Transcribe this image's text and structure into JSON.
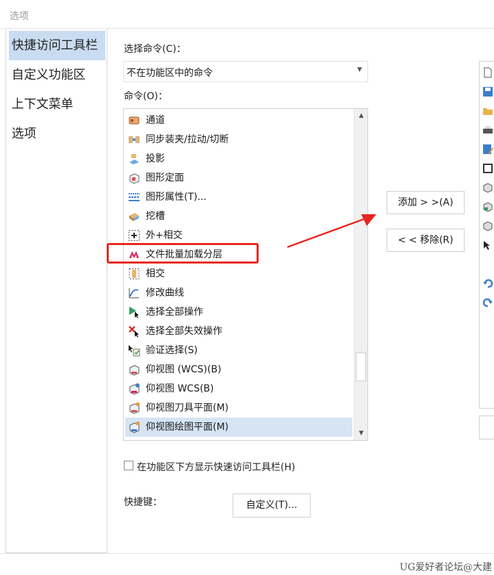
{
  "window": {
    "title": "选项"
  },
  "nav": {
    "items": [
      {
        "label": "快捷访问工具栏",
        "active": true
      },
      {
        "label": "自定义功能区",
        "active": false
      },
      {
        "label": "上下文菜单",
        "active": false
      },
      {
        "label": "选项",
        "active": false
      }
    ]
  },
  "main": {
    "choose_label": "选择命令(C)：",
    "combo_value": "不在功能区中的命令",
    "commands_label": "命令(O)：",
    "commands": [
      {
        "label": "通道",
        "icon": "channel-icon"
      },
      {
        "label": "同步装夹/拉动/切断",
        "icon": "sync-clamp-icon"
      },
      {
        "label": "投影",
        "icon": "projection-icon"
      },
      {
        "label": "图形定面",
        "icon": "graphic-plane-icon"
      },
      {
        "label": "图形属性(T)...",
        "icon": "graphic-attributes-icon"
      },
      {
        "label": "挖槽",
        "icon": "pocket-icon"
      },
      {
        "label": "外+相交",
        "icon": "outer-intersect-icon"
      },
      {
        "label": "文件批量加载分层",
        "icon": "batch-load-logo-icon"
      },
      {
        "label": "相交",
        "icon": "intersect-icon"
      },
      {
        "label": "修改曲线",
        "icon": "modify-curve-icon"
      },
      {
        "label": "选择全部操作",
        "icon": "select-all-ops-icon"
      },
      {
        "label": "选择全部失效操作",
        "icon": "select-invalid-ops-icon"
      },
      {
        "label": "验证选择(S)",
        "icon": "verify-select-icon"
      },
      {
        "label": "仰视图 (WCS)(B)",
        "icon": "bottom-view-wcs-b-icon"
      },
      {
        "label": "仰视图 WCS(B)",
        "icon": "bottom-view-wcs-icon"
      },
      {
        "label": "仰视图刀具平面(M)",
        "icon": "bottom-view-tool-plane-icon"
      },
      {
        "label": "仰视图绘图平面(M)",
        "icon": "bottom-view-draw-plane-icon",
        "selected": true
      }
    ],
    "add_button": "添加 > >(A)",
    "remove_button": "< < 移除(R)",
    "show_below_label": "在功能区下方显示快速访问工具栏(H)",
    "show_below_checked": false,
    "shortcut_label": "快捷键：",
    "customize_button": "自定义(T)...",
    "accent_highlight_color": "#e8251e"
  },
  "watermark": "UG爱好者论坛@大建"
}
